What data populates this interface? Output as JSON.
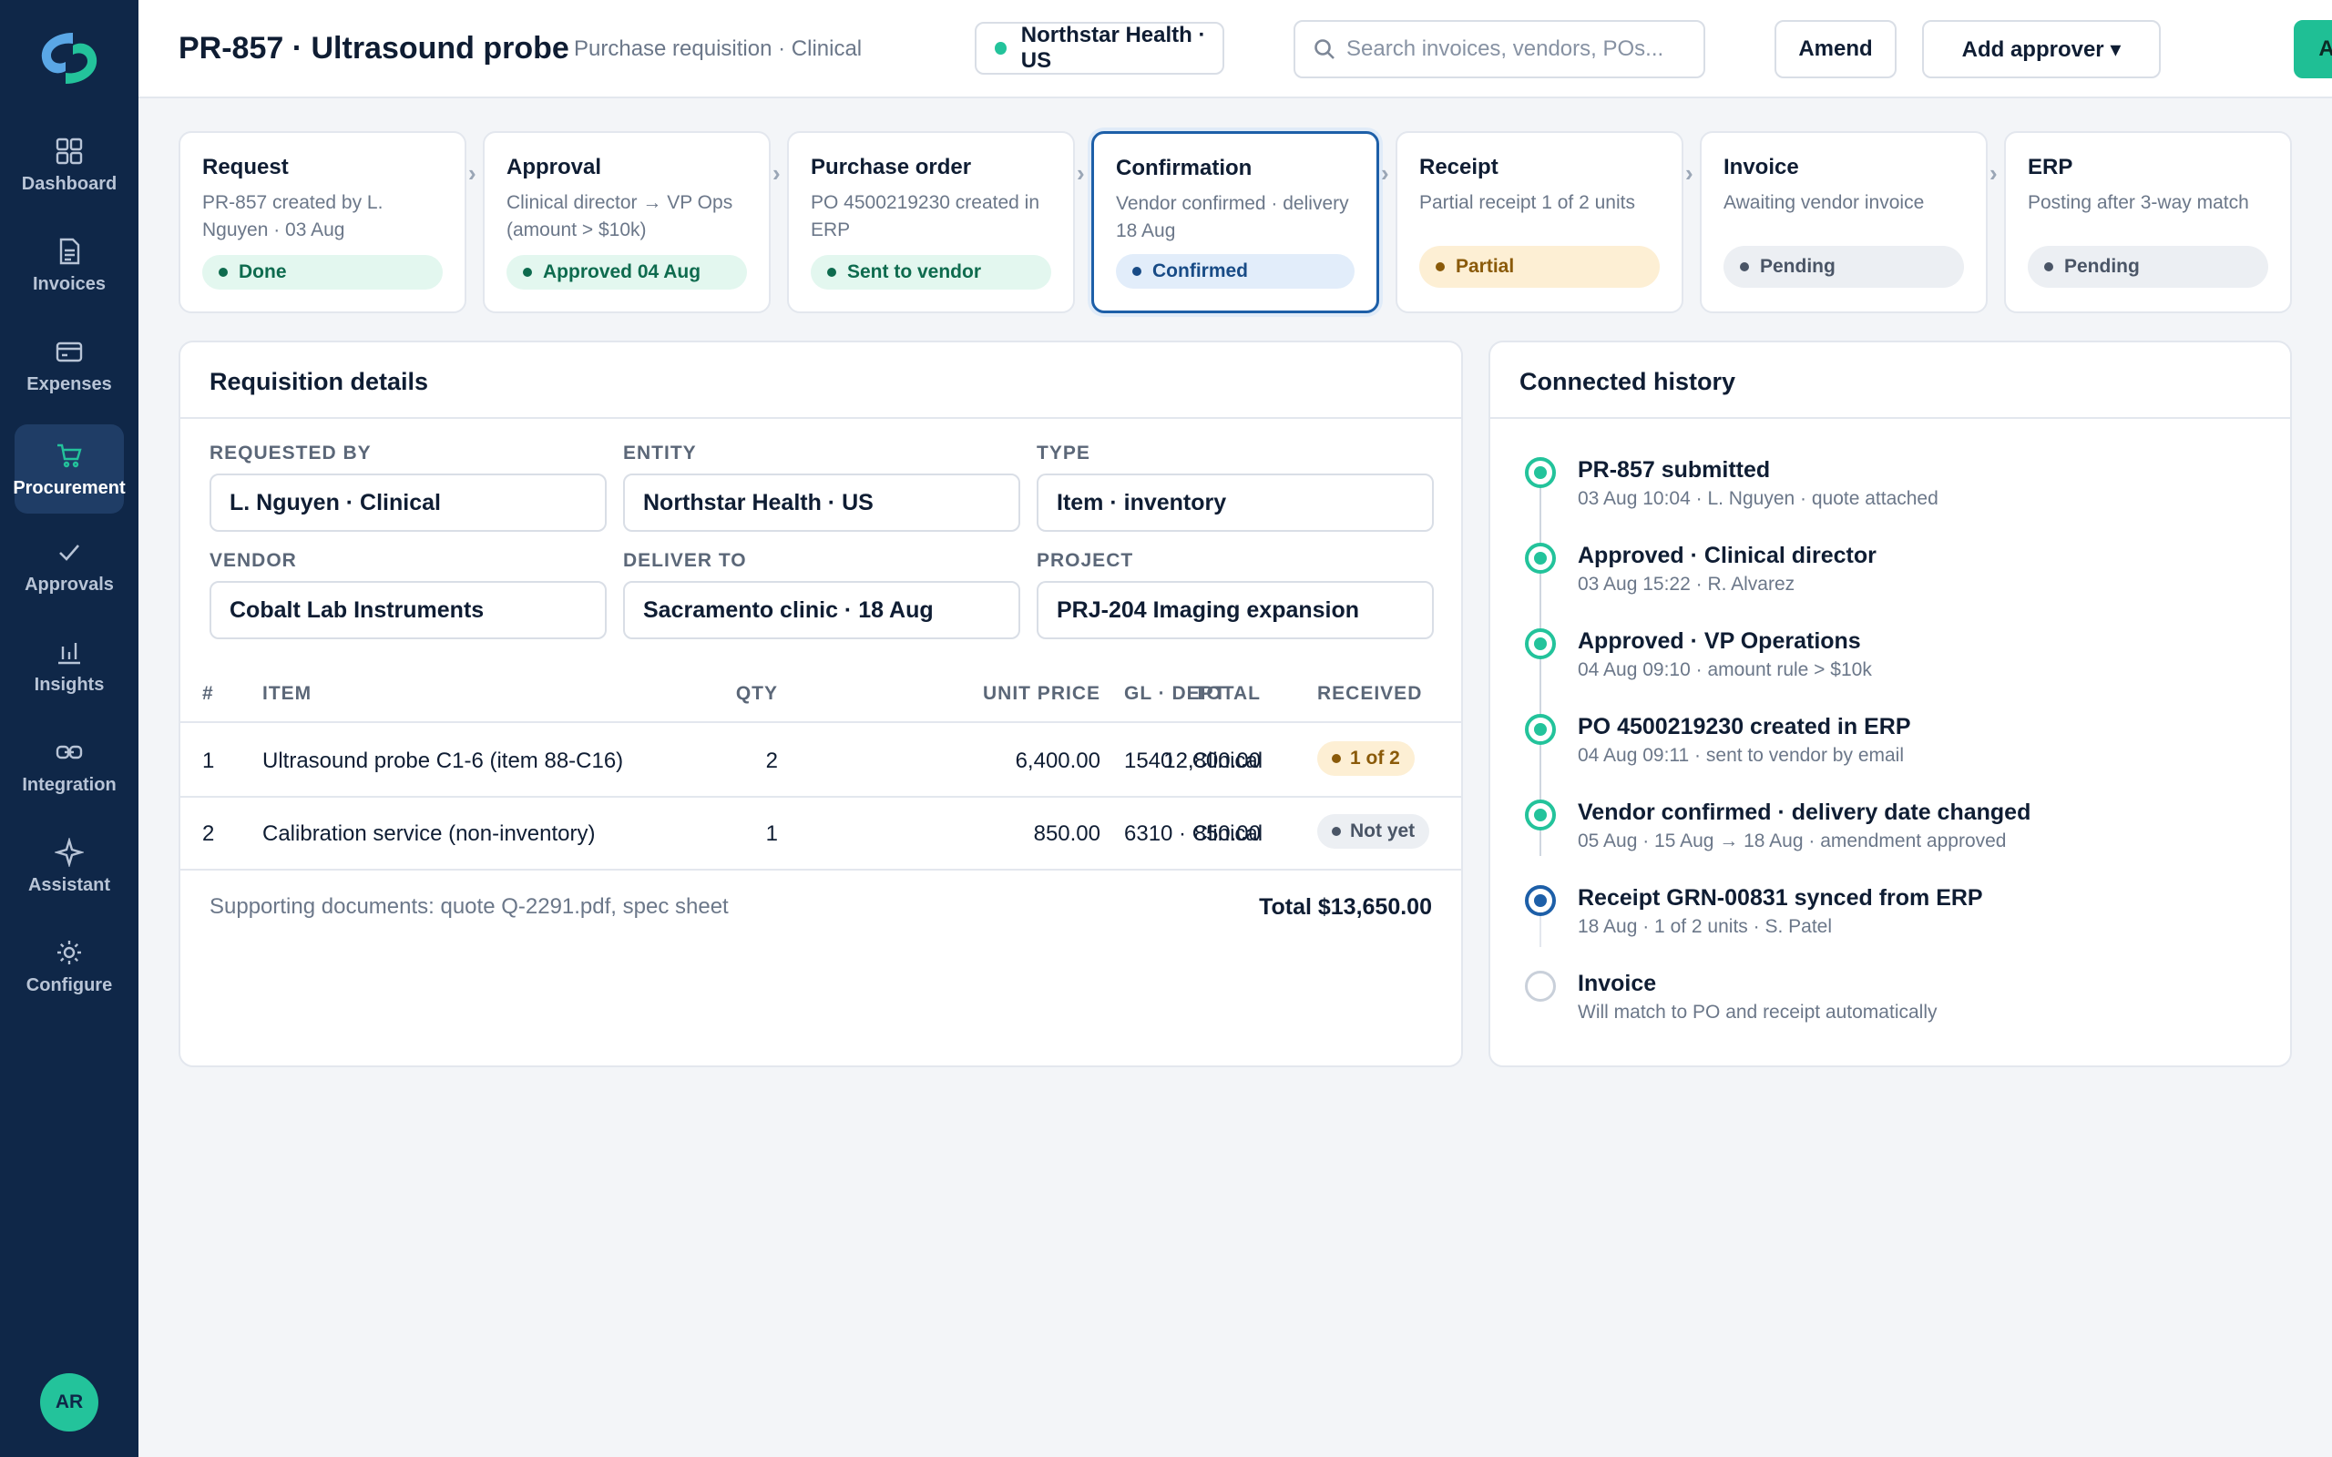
{
  "sidebar": {
    "logo": "app-logo",
    "items": [
      {
        "label": "Dashboard",
        "icon": "grid-icon"
      },
      {
        "label": "Invoices",
        "icon": "document-icon"
      },
      {
        "label": "Expenses",
        "icon": "card-icon"
      },
      {
        "label": "Procurement",
        "icon": "cart-icon",
        "active": true
      },
      {
        "label": "Approvals",
        "icon": "check-icon"
      },
      {
        "label": "Insights",
        "icon": "bar-chart-icon"
      },
      {
        "label": "Integration",
        "icon": "link-icon"
      },
      {
        "label": "Assistant",
        "icon": "sparkle-icon"
      },
      {
        "label": "Configure",
        "icon": "gear-icon"
      }
    ],
    "avatar": "AR"
  },
  "header": {
    "title": "PR-857 · Ultrasound probe",
    "subtitle": "Purchase requisition · Clinical",
    "entity": "Northstar Health · US",
    "search_placeholder": "Search invoices, vendors, POs...",
    "amend_label": "Amend",
    "add_approver_label": "Add approver ▾",
    "approve_label": "Approve"
  },
  "steps": [
    {
      "title": "Request",
      "desc": "PR-857 created by L. Nguyen · 03 Aug",
      "badge": "Done",
      "status": "green"
    },
    {
      "title": "Approval",
      "desc": "Clinical director → VP Ops (amount > $10k)",
      "badge": "Approved 04 Aug",
      "status": "green"
    },
    {
      "title": "Purchase order",
      "desc": "PO 4500219230 created in ERP",
      "badge": "Sent to vendor",
      "status": "green"
    },
    {
      "title": "Confirmation",
      "desc": "Vendor confirmed · delivery 18 Aug",
      "badge": "Confirmed",
      "status": "blue"
    },
    {
      "title": "Receipt",
      "desc": "Partial receipt 1 of 2 units",
      "badge": "Partial",
      "status": "amber"
    },
    {
      "title": "Invoice",
      "desc": "Awaiting vendor invoice",
      "badge": "Pending",
      "status": "grey"
    },
    {
      "title": "ERP",
      "desc": "Posting after 3-way match",
      "badge": "Pending",
      "status": "grey"
    }
  ],
  "details": {
    "title": "Requisition details",
    "fields": {
      "requested_by": {
        "label": "REQUESTED BY",
        "value": "L. Nguyen · Clinical"
      },
      "entity": {
        "label": "ENTITY",
        "value": "Northstar Health · US"
      },
      "type": {
        "label": "TYPE",
        "value": "Item · inventory"
      },
      "vendor": {
        "label": "VENDOR",
        "value": "Cobalt Lab Instruments"
      },
      "deliver_to": {
        "label": "DELIVER TO",
        "value": "Sacramento clinic · 18 Aug"
      },
      "project": {
        "label": "PROJECT",
        "value": "PRJ-204 Imaging expansion"
      }
    },
    "columns": [
      "#",
      "ITEM",
      "QTY",
      "UNIT PRICE",
      "TOTAL",
      "GL · DEPT",
      "RECEIVED"
    ],
    "rows": [
      {
        "num": "1",
        "item": "Ultrasound probe C1-6 (item 88-C16)",
        "qty": "2",
        "unit_price": "6,400.00",
        "total": "12,800.00",
        "gl": "1540 · Clinical",
        "received": "1 of 2"
      },
      {
        "num": "2",
        "item": "Calibration service (non-inventory)",
        "qty": "1",
        "unit_price": "850.00",
        "total": "850.00",
        "gl": "6310 · Clinical",
        "received": "Not yet"
      }
    ],
    "supporting": "Supporting documents: quote Q-2291.pdf, spec sheet",
    "total": "Total $13,650.00"
  },
  "history": {
    "title": "Connected history",
    "events": [
      {
        "title": "PR-857 submitted",
        "sub": "03 Aug 10:04 · L. Nguyen · quote attached",
        "state": "done"
      },
      {
        "title": "Approved · Clinical director",
        "sub": "03 Aug 15:22 · R. Alvarez",
        "state": "done"
      },
      {
        "title": "Approved · VP Operations",
        "sub": "04 Aug 09:10 · amount rule > $10k",
        "state": "done"
      },
      {
        "title": "PO 4500219230 created in ERP",
        "sub": "04 Aug 09:11 · sent to vendor by email",
        "state": "done"
      },
      {
        "title": "Vendor confirmed · delivery date changed",
        "sub": "05 Aug · 15 Aug → 18 Aug · amendment approved",
        "state": "done"
      },
      {
        "title": "Receipt GRN-00831 synced from ERP",
        "sub": "18 Aug · 1 of 2 units · S. Patel",
        "state": "current"
      },
      {
        "title": "Invoice",
        "sub": "Will match to PO and receipt automatically",
        "state": "pending"
      }
    ]
  },
  "colors": {
    "sidebar": "#0f2748",
    "accent": "#1fbf95",
    "active_step": "#1d5fa8"
  }
}
